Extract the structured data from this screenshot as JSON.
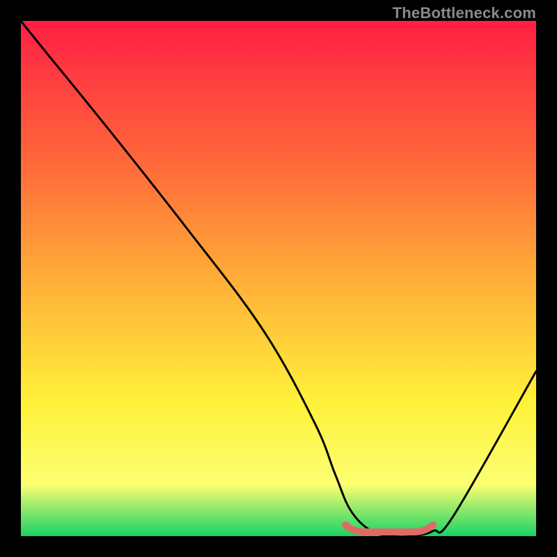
{
  "watermark": "TheBottleneck.com",
  "colors": {
    "black": "#000000",
    "curve": "#000000",
    "highlight": "#de6b66",
    "grad_top": "#ff1f44",
    "grad_mid1": "#ff6a3a",
    "grad_mid2": "#ffb338",
    "grad_mid3": "#fff13a",
    "grad_mid4": "#fcff72",
    "grad_bot": "#18d264",
    "watermark_color": "#8a8a8a"
  },
  "chart_data": {
    "type": "line",
    "title": "",
    "xlabel": "",
    "ylabel": "",
    "xlim": [
      0,
      100
    ],
    "ylim": [
      0,
      100
    ],
    "x": [
      0,
      4,
      17,
      32,
      47,
      57,
      61,
      64,
      68,
      72,
      76,
      80,
      84,
      100
    ],
    "values": [
      100,
      95,
      79,
      60,
      40,
      22,
      12,
      5,
      1,
      0,
      0,
      1,
      4,
      32
    ],
    "highlight_segment": {
      "x_start": 63,
      "x_end": 80,
      "y_level": 0
    }
  }
}
